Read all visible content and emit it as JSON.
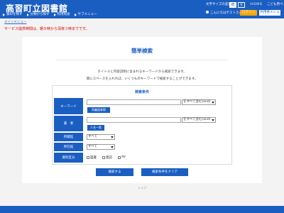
{
  "header": {
    "site_title": "高習町立図書館",
    "font_size_label": "文字サイズの変更",
    "font_size_standard": "標",
    "font_size_large": "大",
    "home_link": "ＨＯＭＥ",
    "kids_link": "こども用ペ",
    "user_greeting": "こんにちはゲストさん",
    "login_button": "ログイン",
    "user_menu_button": "利用者メニュー"
  },
  "nav": {
    "items": [
      {
        "label": "資料を探す"
      },
      {
        "label": "分類から探す"
      },
      {
        "label": "利用照会"
      },
      {
        "label": "サブメニュー"
      }
    ]
  },
  "breadcrumb": "メインメニュー",
  "notice": "サービス提供時間は、朝９時から深夜３時までです。",
  "main": {
    "title": "簡単検索",
    "description_line1": "タイトルと内容説明に含まれるキーワードから検索できます。",
    "description_line2": "間にスペースを入れれば、いくつものキーワードで検索することができます。"
  },
  "form": {
    "title": "検索条件",
    "keyword_label": "キーワード",
    "keyword_value": "",
    "keyword_mode": "をすべて含む(and)",
    "related_words_button": "同義語参照",
    "author_label": "著　者",
    "author_value": "",
    "author_mode": "をすべて含む(and)",
    "author_list_button": "人名一覧",
    "library_label": "所蔵館",
    "library_value": "すべて",
    "location_label": "所在館",
    "location_value": "すべて",
    "material_label": "資料区分",
    "material_options": [
      "図書",
      "雑誌",
      "AV"
    ],
    "search_button": "検索する",
    "clear_button": "検索条件をクリア"
  },
  "pagetop": "トップ",
  "colors": {
    "brand": "#1b5ec2",
    "accent": "#f7a70a",
    "notice": "#d90000"
  }
}
